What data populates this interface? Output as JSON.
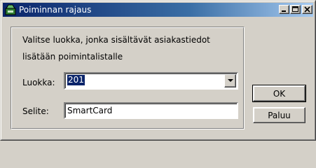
{
  "window": {
    "title": "Poiminnan rajaus",
    "icon": "filter-app-icon",
    "controls": [
      "minimize-icon",
      "maximize-icon",
      "close-icon"
    ]
  },
  "dialog": {
    "description_line1": "Valitse luokka, jonka sisältävät asiakastiedot",
    "description_line2": "lisätään poimintalistalle",
    "luokka_label": "Luokka:",
    "luokka_value": "201",
    "selite_label": "Selite:",
    "selite_value": "SmartCard"
  },
  "buttons": {
    "ok_label": "OK",
    "paluu_label": "Paluu"
  }
}
